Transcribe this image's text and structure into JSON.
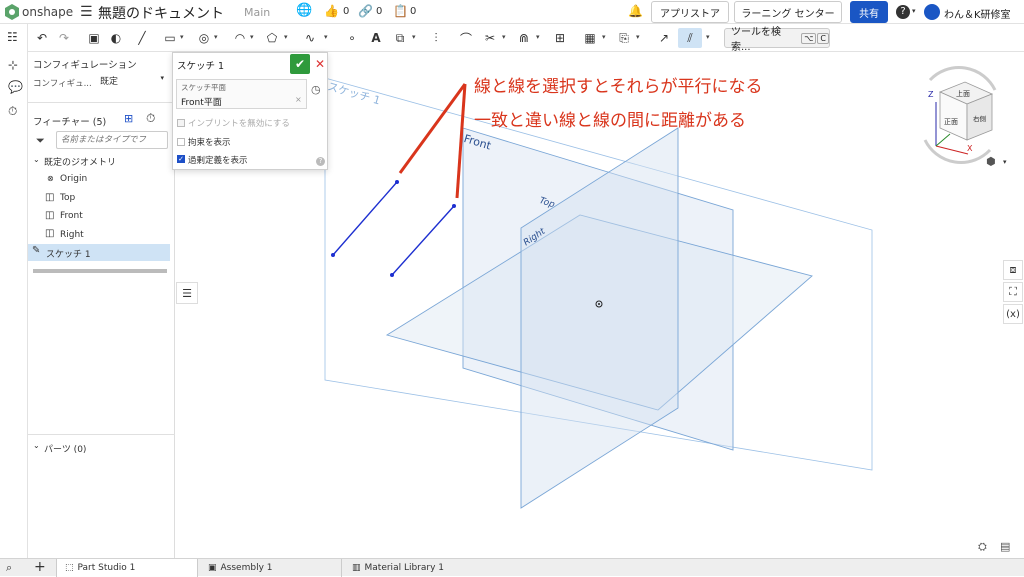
{
  "topbar": {
    "brand": "onshape",
    "doc_title": "無題のドキュメント",
    "branch": "Main",
    "likes": "0",
    "links": "0",
    "copies": "0",
    "app_store": "アプリストア",
    "learning_center": "ラーニング センター",
    "share": "共有",
    "user": "わん＆K研修室"
  },
  "toolbar": {
    "search_label": "ツールを検索...",
    "search_shortcut_alt": "⌥",
    "search_shortcut_key": "C"
  },
  "feature_panel": {
    "config_title": "コンフィギュレーション",
    "config_label": "コンフィギュ...",
    "config_value": "既定",
    "features_title": "フィーチャー (5)",
    "filter_placeholder": "名前またはタイプでフ",
    "default_geometry": "既定のジオメトリ",
    "items": [
      "Origin",
      "Top",
      "Front",
      "Right"
    ],
    "sketch_item": "スケッチ 1",
    "parts": "パーツ (0)"
  },
  "sketch_dialog": {
    "title": "スケッチ 1",
    "plane_label": "スケッチ平面",
    "plane_value": "Front平面",
    "opt_implicit": "インプリントを無効にする",
    "opt_constraints": "拘束を表示",
    "opt_overdefined": "過剰定義を表示"
  },
  "viewport": {
    "sketch_label": "スケッチ 1",
    "front_label": "Front",
    "top_label": "Top",
    "right_label": "Right",
    "viewcube_top": "上面",
    "viewcube_front": "正面",
    "viewcube_right": "右側",
    "axis_z": "Z",
    "axis_x": "X"
  },
  "annotation": {
    "line1": "線と線を選択すとそれらが平行になる",
    "line2": "一致と違い線と線の間に距離がある",
    "color": "#d9351c"
  },
  "bottom_tabs": {
    "tab1": "Part Studio 1",
    "tab2": "Assembly 1",
    "tab3": "Material Library 1"
  },
  "colors": {
    "accent_blue": "#1d4fc7",
    "share_bg": "#1a56c4",
    "confirm_green": "#2f9a3c",
    "plane_stroke": "#7aa6d6",
    "selection_bg": "#cfe3f5"
  }
}
